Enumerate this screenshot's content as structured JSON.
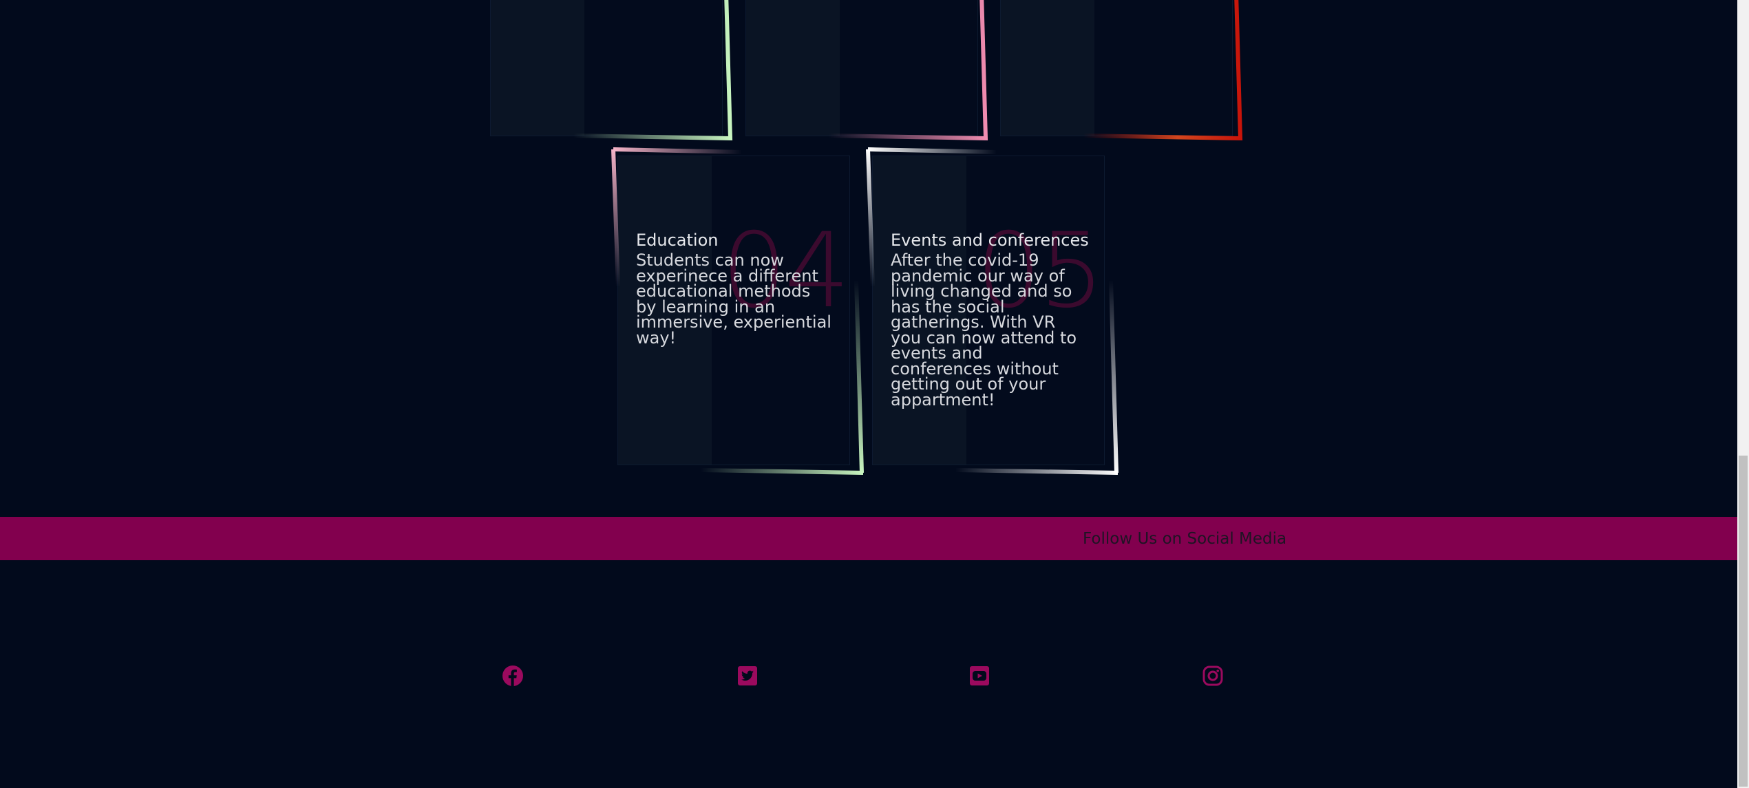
{
  "cards": [
    {
      "number": "04",
      "title": "Education",
      "description": "Students can now experinece a different educational methods by learning in an immersive, experiential way!"
    },
    {
      "number": "05",
      "title": "Events and conferences",
      "description": "After the covid-19 pandemic our way of living changed and so has the social gatherings. With VR you can now attend to events and conferences without getting out of your appartment!"
    }
  ],
  "follow": {
    "label": "Follow Us on Social Media"
  },
  "social": [
    {
      "icon": "facebook-icon"
    },
    {
      "icon": "twitter-icon"
    },
    {
      "icon": "youtube-icon"
    },
    {
      "icon": "instagram-icon"
    }
  ],
  "colors": {
    "background": "#020a1c",
    "accent": "#82004e",
    "icon": "#9b0a5e",
    "frame_green": "#c8f5c0",
    "frame_pink": "#f08cb0",
    "frame_red": "#c8140a",
    "frame_white": "#ffffff"
  }
}
